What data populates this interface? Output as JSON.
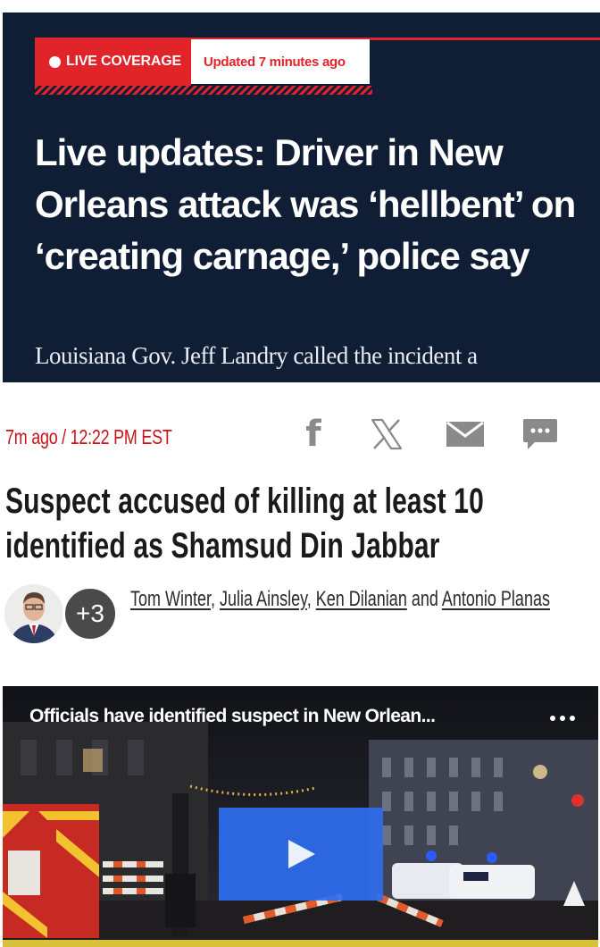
{
  "hero": {
    "badge_live": "LIVE COVERAGE",
    "badge_updated": "Updated 7 minutes ago",
    "headline": "Live updates: Driver in New Orleans attack was ‘hellbent’ on ‘creating carnage,’ police say",
    "dek": "Louisiana Gov. Jeff Landry called the incident a"
  },
  "post": {
    "timestamp": "7m ago / 12:22 PM EST",
    "share_icons": [
      "facebook-icon",
      "x-icon",
      "mail-icon",
      "comment-icon"
    ],
    "title": "Suspect accused of killing at least 10 identified as Shamsud Din Jabbar",
    "more_authors": "+3",
    "authors": [
      "Tom Winter",
      "Julia Ainsley",
      "Ken Dilanian",
      "Antonio Planas"
    ],
    "byline_sep1": ",",
    "byline_sep2": ",",
    "byline_and": "and"
  },
  "video": {
    "title": "Officials have identified suspect in New Orlean..."
  },
  "colors": {
    "hero_bg": "#0f1d35",
    "accent_red": "#e0242a",
    "timestamp_red": "#c7141b",
    "play_blue": "#2e6ef0"
  }
}
